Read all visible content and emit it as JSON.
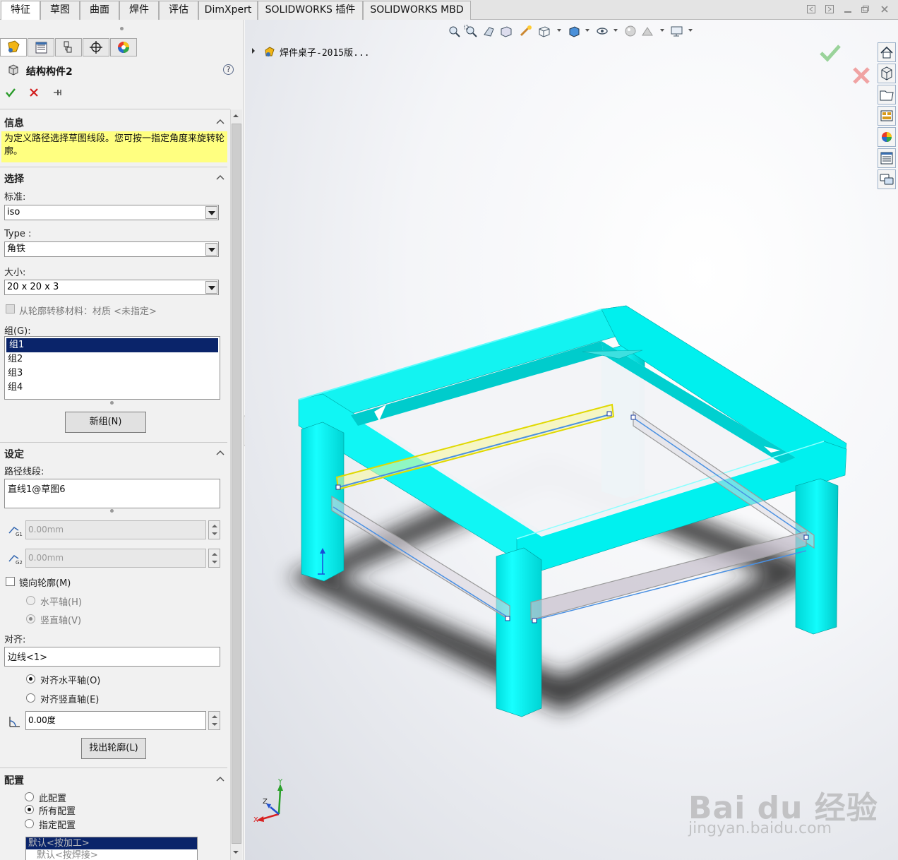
{
  "tabs": [
    {
      "label": "特征",
      "active": true
    },
    {
      "label": "草图",
      "active": false
    },
    {
      "label": "曲面",
      "active": false
    },
    {
      "label": "焊件",
      "active": false
    },
    {
      "label": "评估",
      "active": false
    },
    {
      "label": "DimXpert",
      "active": false
    },
    {
      "label": "SOLIDWORKS 插件",
      "active": false
    },
    {
      "label": "SOLIDWORKS MBD",
      "active": false
    }
  ],
  "property_manager": {
    "title": "结构构件2",
    "help_label": "?",
    "info": {
      "title": "信息",
      "message": "为定义路径选择草图线段。您可按一指定角度来旋转轮廓。",
      "highlight_color": "#ffff80"
    },
    "selection": {
      "title": "选择",
      "standard_label": "标准:",
      "standard_value": "iso",
      "type_label": "Type :",
      "type_value": "角铁",
      "size_label": "大小:",
      "size_value": "20 x 20 x 3",
      "transfer_material_label": "从轮廓转移材料：材质 <未指定>",
      "group_label": "组(G):",
      "groups": [
        "组1",
        "组2",
        "组3",
        "组4"
      ],
      "new_group_button": "新组(N)"
    },
    "settings": {
      "title": "设定",
      "path_segments_label": "路径线段:",
      "path_segments_value": "直线1@草图6",
      "offset1_value": "0.00mm",
      "offset2_value": "0.00mm",
      "mirror_profile_label": "镜向轮廓(M)",
      "horizontal_axis_label": "水平轴(H)",
      "vertical_axis_label": "竖直轴(V)",
      "alignment_label": "对齐:",
      "alignment_value": "边线<1>",
      "align_horizontal_label": "对齐水平轴(O)",
      "align_vertical_label": "对齐竖直轴(E)",
      "rotation_value": "0.00度",
      "locate_profile_button": "找出轮廓(L)"
    },
    "configuration": {
      "title": "配置",
      "this_config_label": "此配置",
      "all_configs_label": "所有配置",
      "specified_config_label": "指定配置",
      "config_list": [
        "默认<按加工>",
        "默认<按焊接>"
      ]
    }
  },
  "viewport": {
    "tree_item": "焊件桌子-2015版...",
    "model_color": "#00f0ee",
    "triad_axes": [
      "Y",
      "Z",
      "X"
    ]
  },
  "watermark": {
    "brand": "Bai du 经验",
    "url": "jingyan.baidu.com"
  }
}
